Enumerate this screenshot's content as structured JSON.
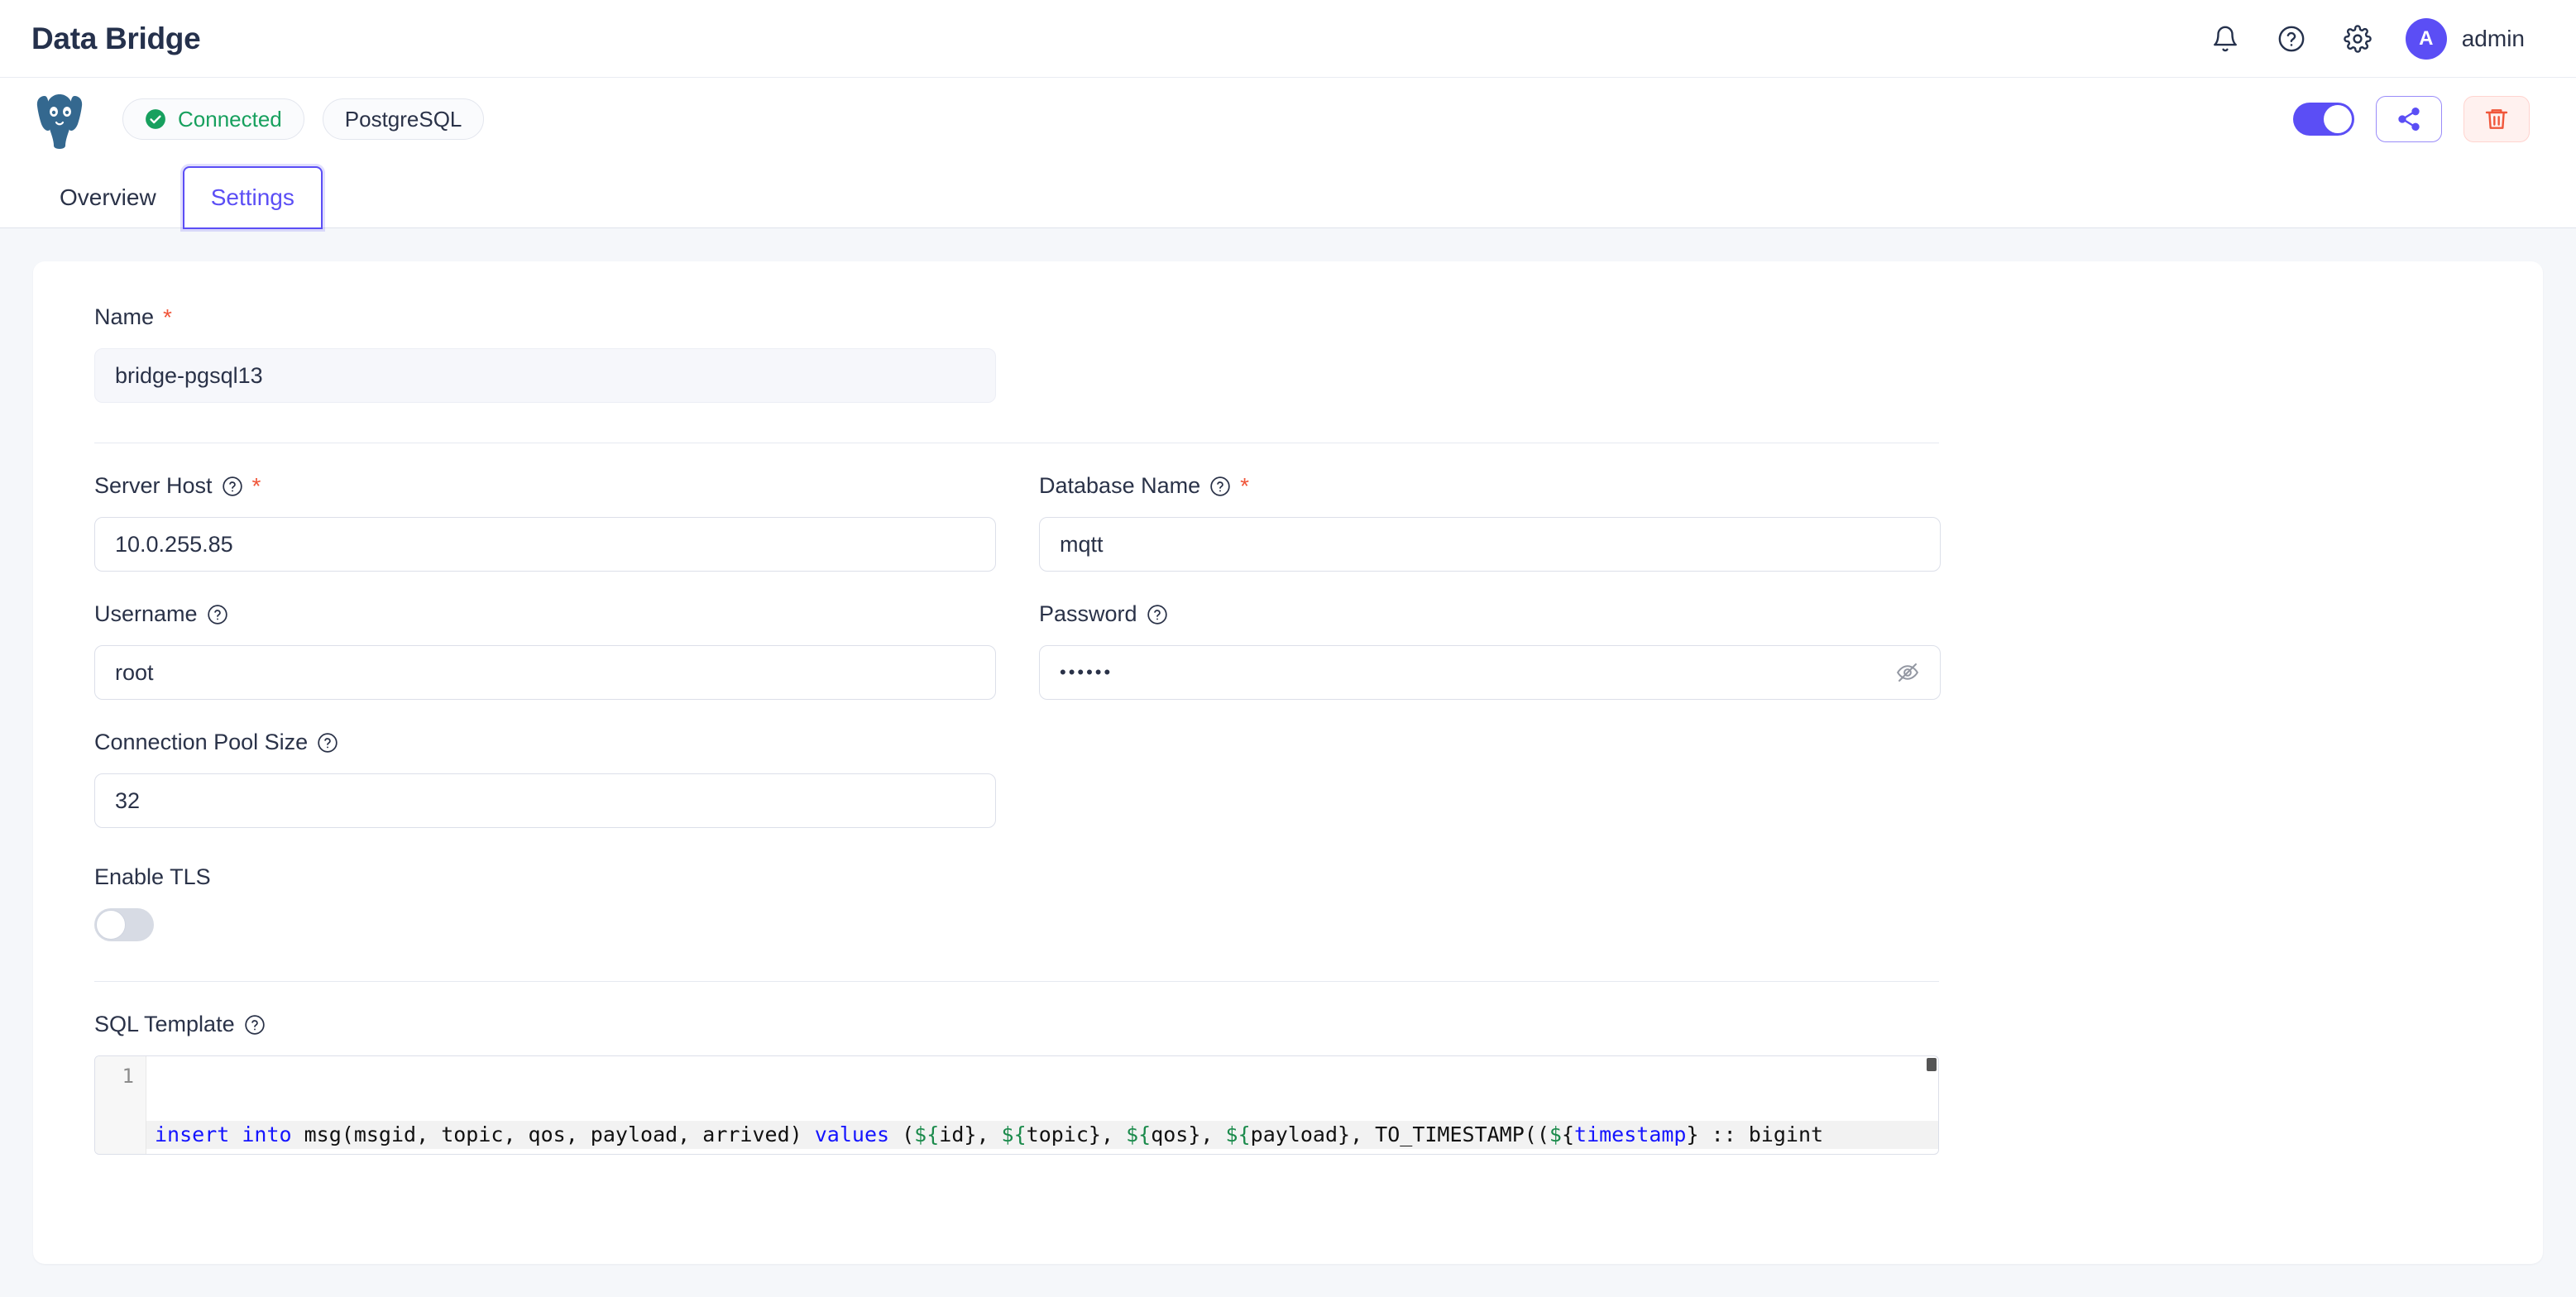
{
  "header": {
    "title": "Data Bridge",
    "icons": [
      "bell-icon",
      "help-circle-icon",
      "gear-icon"
    ],
    "user": {
      "initial": "A",
      "name": "admin"
    }
  },
  "bridge": {
    "logo": "postgresql-elephant-logo",
    "status_label": "Connected",
    "type_label": "PostgreSQL",
    "enabled_toggle": true,
    "actions": {
      "share": "share-icon",
      "delete": "trash-icon"
    }
  },
  "tabs": [
    {
      "label": "Overview",
      "active": false
    },
    {
      "label": "Settings",
      "active": true
    }
  ],
  "form": {
    "name": {
      "label": "Name",
      "required": true,
      "value": "bridge-pgsql13",
      "disabled": true
    },
    "server_host": {
      "label": "Server Host",
      "required": true,
      "help": true,
      "value": "10.0.255.85"
    },
    "database_name": {
      "label": "Database Name",
      "required": true,
      "help": true,
      "value": "mqtt"
    },
    "username": {
      "label": "Username",
      "required": false,
      "help": true,
      "value": "root"
    },
    "password": {
      "label": "Password",
      "required": false,
      "help": true,
      "value": "••••••",
      "masked": true
    },
    "pool_size": {
      "label": "Connection Pool Size",
      "required": false,
      "help": true,
      "value": "32"
    },
    "enable_tls": {
      "label": "Enable TLS",
      "value": false
    },
    "sql_template": {
      "label": "SQL Template",
      "help": true,
      "line_number": "1",
      "code": {
        "kw1": "insert into",
        "mid1": " msg(msgid, topic, qos, payload, arrived) ",
        "kw2": "values",
        "open": " (",
        "p1": "${id}",
        "p2": "${topic}",
        "p3": "${qos}",
        "p4": "${payload}",
        "fn": ", TO_TIMESTAMP((",
        "p5": "${timestamp}",
        "tail": " :: bigint"
      }
    }
  },
  "colors": {
    "accent": "#5b4ef5",
    "success": "#17a05e",
    "danger": "#f0563a",
    "title": "#25314c"
  }
}
